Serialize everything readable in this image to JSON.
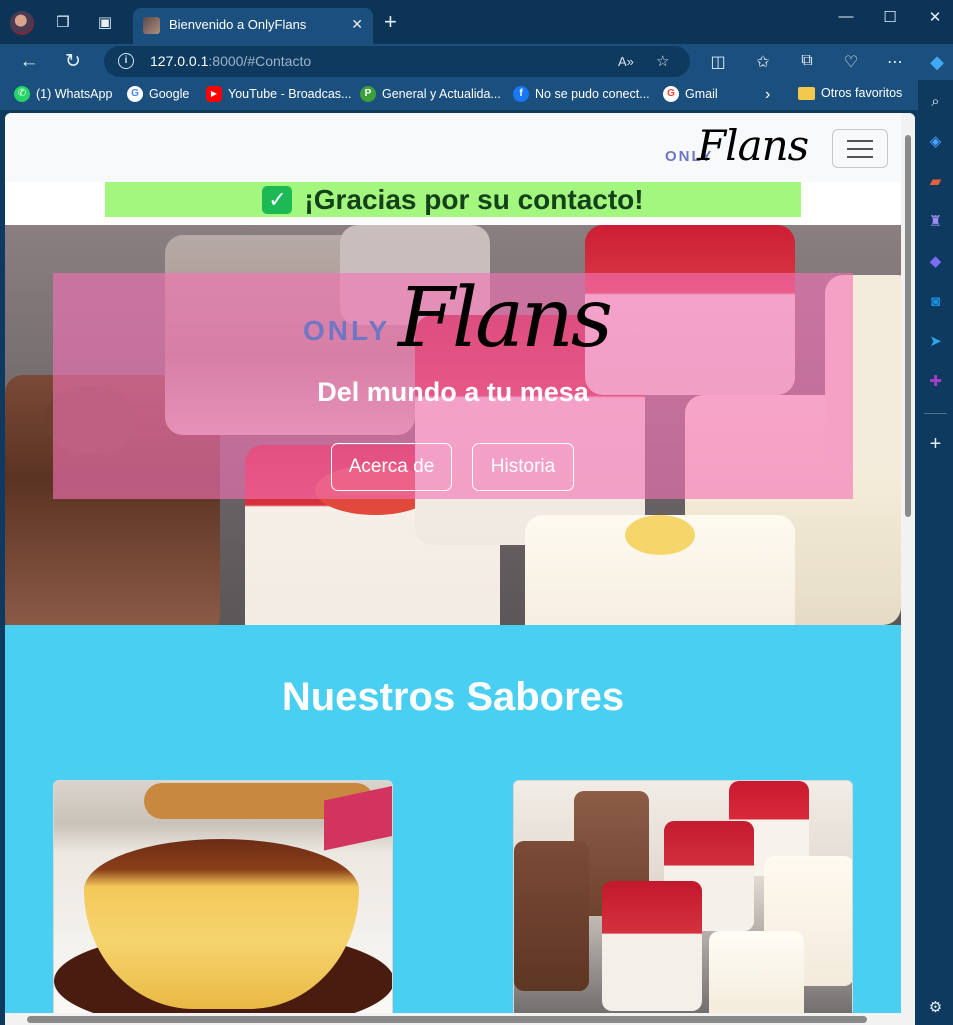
{
  "browser": {
    "tab_title": "Bienvenido a OnlyFlans",
    "url_host": "127.0.0.1",
    "url_path": ":8000/#Contacto",
    "new_tab_icon": "plus-icon",
    "window_controls": [
      "minimize-icon",
      "maximize-icon",
      "close-icon"
    ]
  },
  "bookmarks": [
    {
      "label": "(1) WhatsApp",
      "icon": "whatsapp-icon",
      "color": "#25d366"
    },
    {
      "label": "Google",
      "icon": "google-icon",
      "color": "#ffffff"
    },
    {
      "label": "YouTube - Broadcas...",
      "icon": "youtube-icon",
      "color": "#ff0000"
    },
    {
      "label": "General y Actualida...",
      "icon": "p-icon",
      "color": "#3e9f3a"
    },
    {
      "label": "No se pudo conect...",
      "icon": "facebook-icon",
      "color": "#1877f2"
    },
    {
      "label": "Gmail",
      "icon": "google-icon",
      "color": "#ffffff"
    }
  ],
  "bookmarks_other": "Otros favoritos",
  "site": {
    "brand_only": "ONLY",
    "brand_flans": "Flans",
    "alert": "¡Gracias por su contacto!",
    "hero": {
      "only": "ONLY",
      "flans": "Flans",
      "tagline": "Del mundo a tu mesa",
      "btn_about": "Acerca de",
      "btn_history": "Historia"
    },
    "sabores_title": "Nuestros Sabores"
  },
  "colors": {
    "alert_bg": "#a3f77f",
    "hero_overlay": "#f472b6",
    "sabores_bg": "#48cff1",
    "brand_only": "#6f76c4"
  }
}
